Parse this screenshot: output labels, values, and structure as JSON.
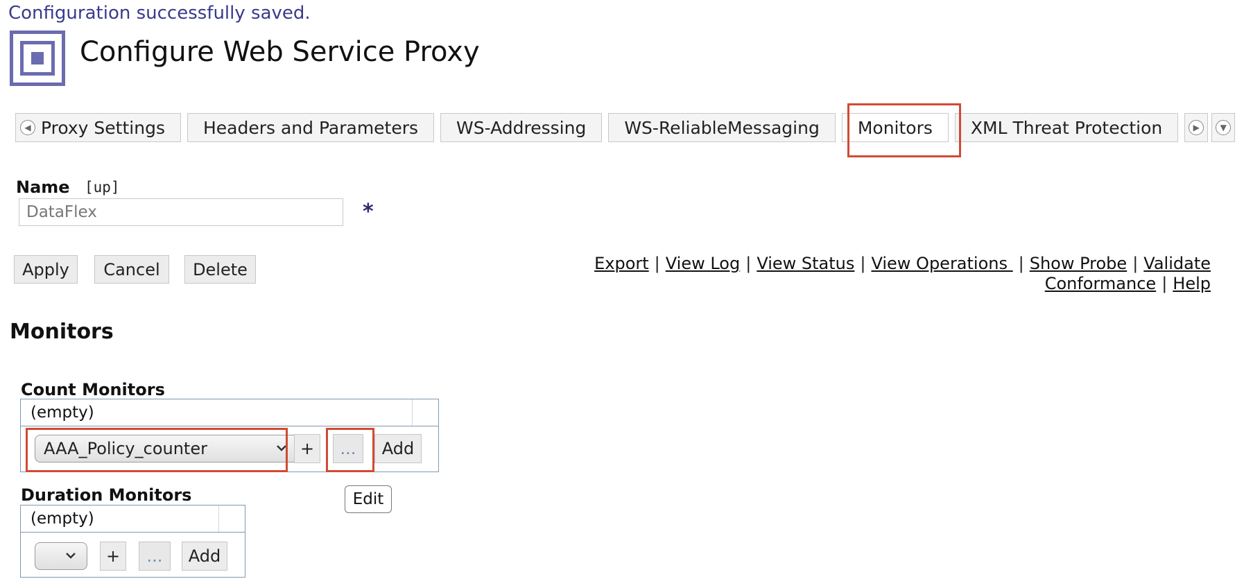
{
  "status_message": "Configuration successfully saved.",
  "page_title": "Configure Web Service Proxy",
  "tabs": [
    {
      "label": "Proxy Settings"
    },
    {
      "label": "Headers and Parameters"
    },
    {
      "label": "WS-Addressing"
    },
    {
      "label": "WS-ReliableMessaging"
    },
    {
      "label": "Monitors",
      "active": true
    },
    {
      "label": "XML Threat Protection"
    }
  ],
  "name_field": {
    "label": "Name",
    "state": "[up]",
    "value": "DataFlex",
    "required_marker": "*"
  },
  "actions": {
    "apply": "Apply",
    "cancel": "Cancel",
    "delete": "Delete"
  },
  "links": {
    "export": "Export",
    "view_log": "View Log",
    "view_status": "View Status",
    "view_operations": "View Operations ",
    "show_probe": "Show Probe",
    "validate_conformance_1": "Validate",
    "validate_conformance_2": "Conformance",
    "help": "Help"
  },
  "monitors": {
    "section_title": "Monitors",
    "count": {
      "title": "Count Monitors",
      "empty_text": "(empty)",
      "selected": "AAA_Policy_counter",
      "plus": "+",
      "edit": "...",
      "add": "Add"
    },
    "duration": {
      "title": "Duration Monitors",
      "empty_text": "(empty)",
      "selected": "",
      "plus": "+",
      "edit": "...",
      "add": "Add"
    }
  },
  "tooltip": "Edit",
  "colors": {
    "highlight": "#d04a32",
    "panel_border": "#7e98b0",
    "status_text": "#3a3a8c"
  }
}
